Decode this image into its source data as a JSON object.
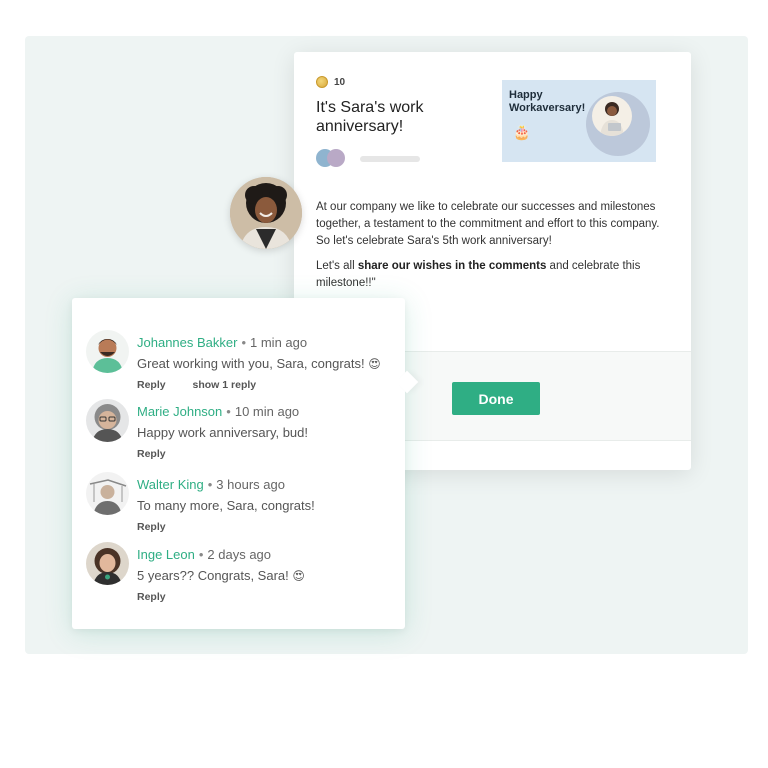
{
  "post": {
    "coins": "10",
    "title": "It's Sara's work anniversary!",
    "banner": {
      "line1": "Happy",
      "line2": "Workaversary!"
    },
    "paragraph1": "At our company we like to celebrate our successes and milestones together, a testament to the commitment and effort to this company. So let's celebrate Sara's 5th work anniversary!",
    "paragraph2_before": "Let's all ",
    "paragraph2_bold": "share our wishes in the comments",
    "paragraph2_after": " and celebrate this milestone!!\"",
    "done_label": "Done",
    "colors": {
      "accent": "#2fae84",
      "banner_bg": "#d6e5f2"
    }
  },
  "comments": [
    {
      "name": "Johannes Bakker",
      "time": "1 min ago",
      "text": "Great working with you, Sara, congrats!",
      "emoji": "😍",
      "reply": "Reply",
      "show_replies": "show 1 reply"
    },
    {
      "name": "Marie Johnson",
      "time": "10 min ago",
      "text": "Happy work anniversary, bud!",
      "reply": "Reply"
    },
    {
      "name": "Walter King",
      "time": "3 hours ago",
      "text": "To many more, Sara, congrats!",
      "reply": "Reply"
    },
    {
      "name": "Inge Leon",
      "time": "2 days ago",
      "text": "5 years?? Congrats, Sara!",
      "emoji": "😍",
      "reply": "Reply"
    }
  ],
  "separator": "•"
}
